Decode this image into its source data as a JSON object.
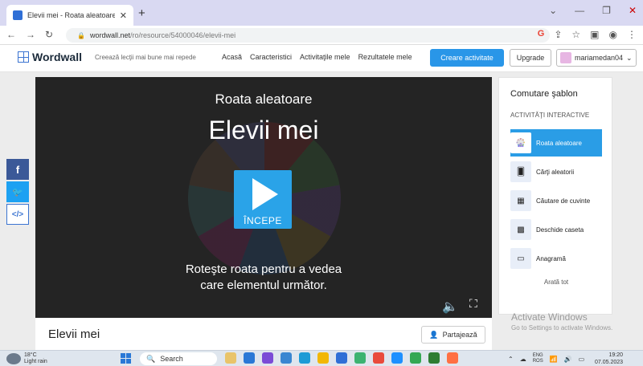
{
  "browser": {
    "tab_title": "Elevii mei - Roata aleatoare",
    "url_host": "wordwall.net",
    "url_path": "/ro/resource/54000046/elevii-mei"
  },
  "header": {
    "logo": "Wordwall",
    "tagline": "Creează lecţii mai bune mai repede",
    "nav": [
      "Acasă",
      "Caracteristici",
      "Activitaţile mele",
      "Rezultatele mele"
    ],
    "create_label": "Creare activitate",
    "upgrade_label": "Upgrade",
    "username": "mariamedan04"
  },
  "activity": {
    "template_name": "Roata aleatoare",
    "title": "Elevii mei",
    "start_label": "ÎNCEPE",
    "instruction_line1": "Roteşte roata pentru a vedea",
    "instruction_line2": "care elementul următor.",
    "footer_title": "Elevii mei",
    "share_label": "Partajează"
  },
  "templates_panel": {
    "heading": "Comutare şablon",
    "subheading": "ACTIVITĂŢI INTERACTIVE",
    "items": [
      {
        "label": "Roata aleatoare",
        "icon": "wheel-icon",
        "active": true
      },
      {
        "label": "Cărţi aleatorii",
        "icon": "cards-icon",
        "active": false
      },
      {
        "label": "Căutare de cuvinte",
        "icon": "wordsearch-icon",
        "active": false
      },
      {
        "label": "Deschide caseta",
        "icon": "box-icon",
        "active": false
      },
      {
        "label": "Anagramă",
        "icon": "anagram-icon",
        "active": false
      }
    ],
    "show_all": "Arată tot"
  },
  "watermark": {
    "line1": "Activate Windows",
    "line2": "Go to Settings to activate Windows."
  },
  "taskbar": {
    "temp": "18°C",
    "weather": "Light rain",
    "search_label": "Search",
    "lang1": "ENG",
    "lang2": "ROS",
    "time": "19:20",
    "date": "07.05.2023"
  },
  "colors": {
    "accent": "#2996e8",
    "stage_bg": "#242424",
    "start_button": "#2aa3e8"
  }
}
